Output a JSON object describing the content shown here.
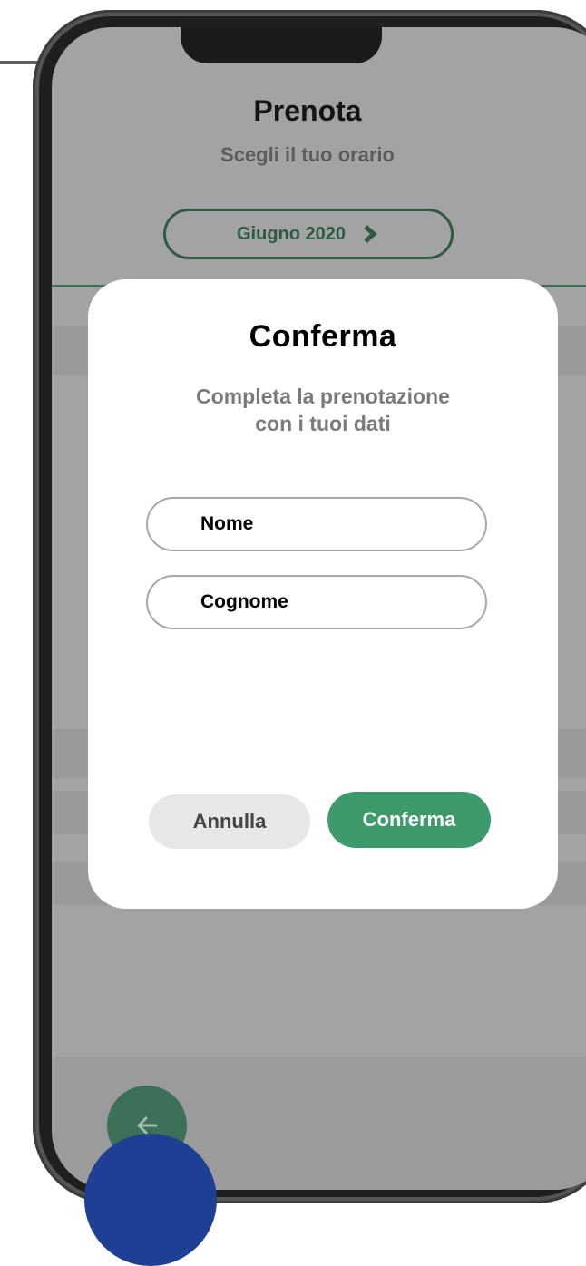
{
  "header": {
    "title": "Prenota",
    "subtitle": "Scegli il tuo orario",
    "month_label": "Giugno 2020"
  },
  "modal": {
    "title": "Conferma",
    "description_line1": "Completa la prenotazione",
    "description_line2": "con i tuoi dati",
    "fields": [
      {
        "value": "Nome"
      },
      {
        "value": "Cognome"
      }
    ],
    "cancel_label": "Annulla",
    "confirm_label": "Conferma"
  },
  "colors": {
    "accent_green": "#3d9b6b",
    "header_green": "#2d5a44",
    "overlay_blue": "#1d3f94"
  },
  "icons": {
    "month_next": "chevron-right-icon",
    "back": "arrow-left-icon"
  }
}
